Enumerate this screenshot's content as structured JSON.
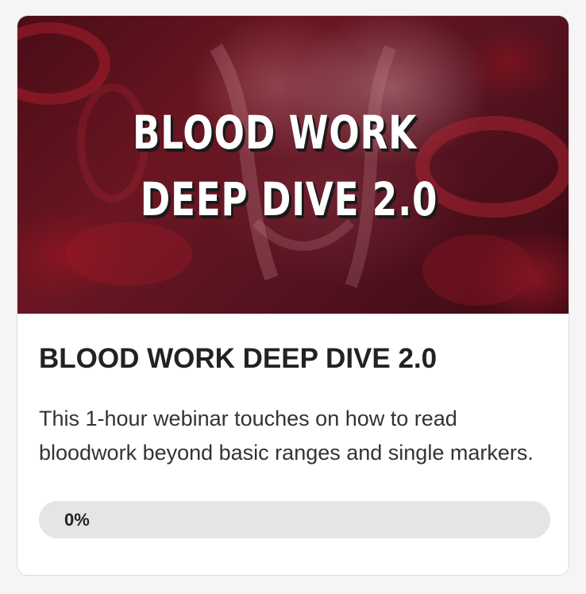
{
  "course_card": {
    "thumbnail": {
      "line1": "BLOOD WORK",
      "line2": "DEEP DIVE 2.0"
    },
    "title": "BLOOD WORK DEEP DIVE 2.0",
    "description": "This 1-hour webinar touches on how to read bloodwork beyond basic ranges and single markers.",
    "progress": {
      "label": "0%",
      "value": 0
    }
  },
  "colors": {
    "background": "#f6f5f4",
    "card": "#ffffff",
    "thumbnail_base": "#5a1420",
    "progress_track": "#e5e5e5",
    "title_text": "#222222"
  }
}
